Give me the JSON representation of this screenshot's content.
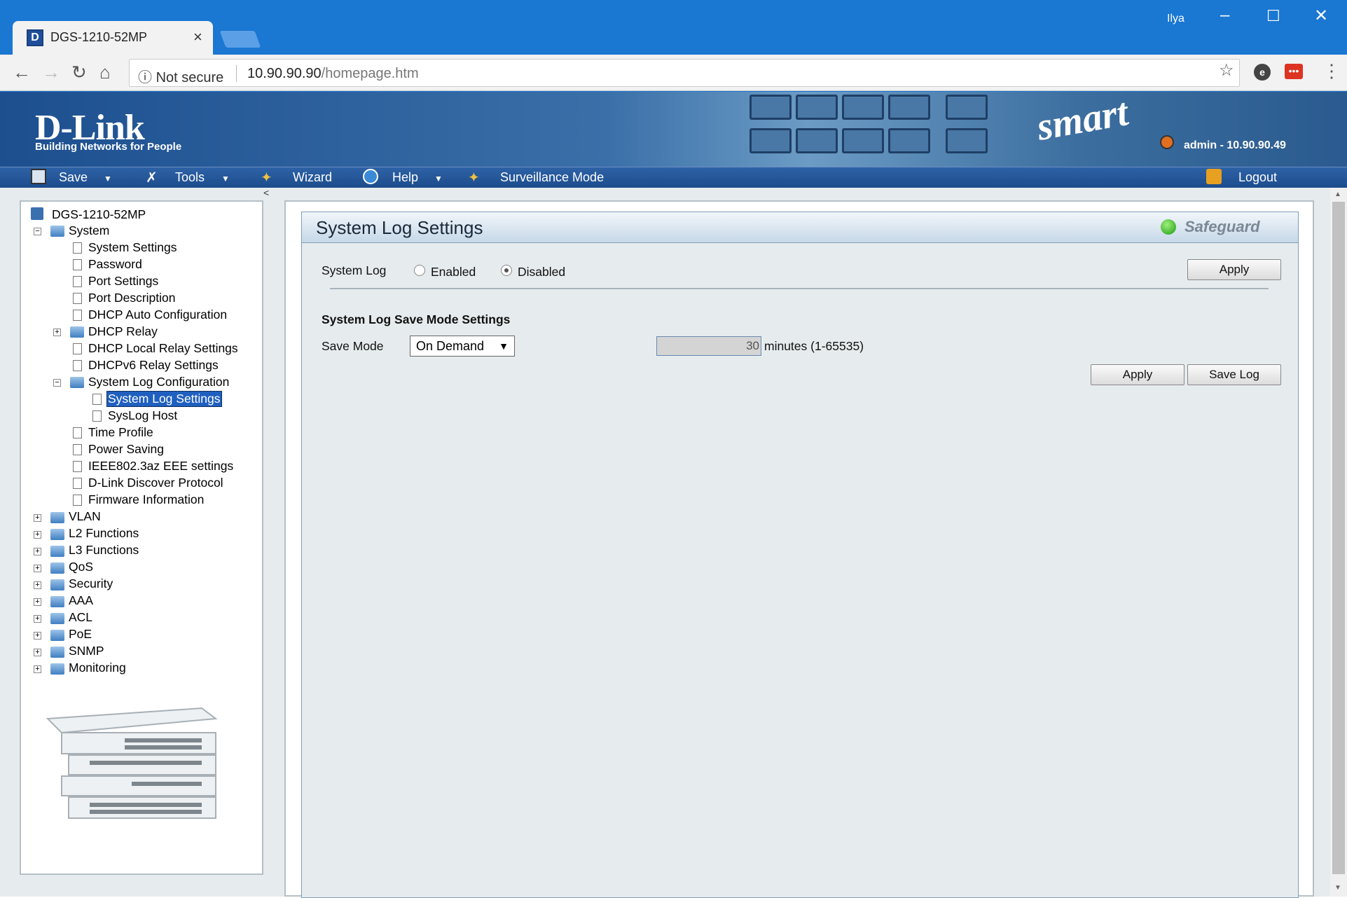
{
  "browser": {
    "tab_title": "DGS-1210-52MP",
    "user": "Ilya",
    "security": "Not secure",
    "url_host": "10.90.90.90",
    "url_path": "/homepage.htm"
  },
  "banner": {
    "logo": "D-Link",
    "tagline": "Building Networks for People",
    "product_mark": "smart",
    "user_info": "admin - 10.90.90.49"
  },
  "menu": {
    "save": "Save",
    "tools": "Tools",
    "wizard": "Wizard",
    "help": "Help",
    "surveillance": "Surveillance Mode",
    "logout": "Logout"
  },
  "tree": {
    "root": "DGS-1210-52MP",
    "system": "System",
    "items": [
      "System Settings",
      "Password",
      "Port Settings",
      "Port Description",
      "DHCP Auto Configuration",
      "DHCP Relay",
      "DHCP Local Relay Settings",
      "DHCPv6 Relay Settings",
      "System Log Configuration",
      "System Log Settings",
      "SysLog Host",
      "Time Profile",
      "Power Saving",
      "IEEE802.3az EEE settings",
      "D-Link Discover Protocol",
      "Firmware Information"
    ],
    "folders": [
      "VLAN",
      "L2 Functions",
      "L3 Functions",
      "QoS",
      "Security",
      "AAA",
      "ACL",
      "PoE",
      "SNMP",
      "Monitoring"
    ]
  },
  "panel": {
    "title": "System Log Settings",
    "safeguard": "Safeguard",
    "system_log_label": "System Log",
    "enabled_label": "Enabled",
    "disabled_label": "Disabled",
    "system_log_state": "Disabled",
    "apply1": "Apply",
    "section_title": "System Log Save Mode Settings",
    "save_mode_label": "Save Mode",
    "save_mode_value": "On Demand",
    "minutes_value": "30",
    "minutes_unit": "minutes (1-65535)",
    "apply2": "Apply",
    "save_log": "Save Log"
  },
  "colors": {
    "menubar": "#1c4c8c",
    "selection": "#1f5fbf",
    "panel_bg": "#e6ecee",
    "safeguard_green": "#1c9a12"
  }
}
